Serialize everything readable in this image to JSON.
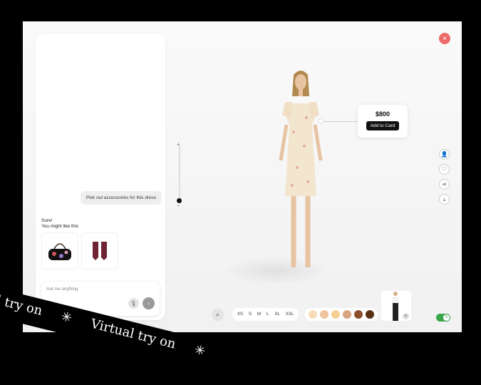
{
  "chat": {
    "user_message": "Pick out accessories for this dress",
    "reply_line1": "Sure!",
    "reply_line2": "You might like this",
    "products": [
      {
        "name": "floral-duffel-bag"
      },
      {
        "name": "burgundy-leather-gloves"
      }
    ],
    "input_placeholder": "Ask me anything"
  },
  "zoom": {
    "plus": "+",
    "minus": "−",
    "level": 0.05
  },
  "product_card": {
    "price": "$800",
    "button": "Add to Card"
  },
  "sizes": [
    "XS",
    "S",
    "M",
    "L",
    "XL",
    "XXL"
  ],
  "skin_tones": [
    "#f7dcb8",
    "#efc49f",
    "#f5cf93",
    "#d8a582",
    "#8b4f2b",
    "#5a3014"
  ],
  "close_icon": "×",
  "toggle_label": "$",
  "banner": {
    "text1": "l try on",
    "text2": "Virtual try on",
    "star": "✳"
  },
  "colors": {
    "close": "#ec6a6a",
    "toggle": "#3aa64a"
  }
}
